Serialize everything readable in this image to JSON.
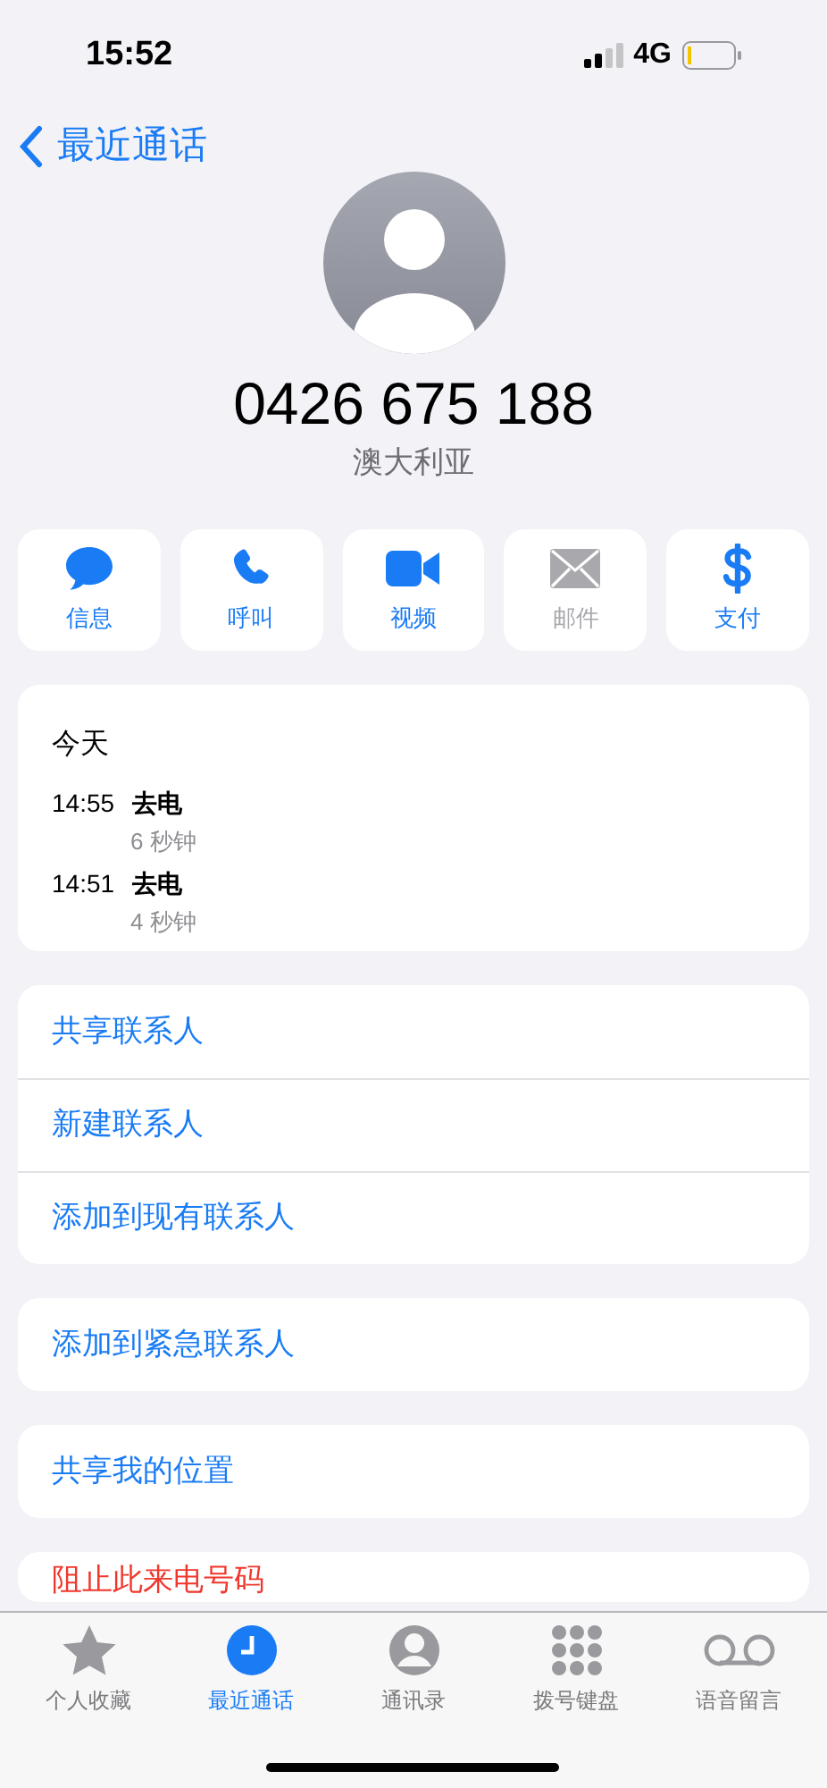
{
  "status_bar": {
    "time": "15:52",
    "network": "4G"
  },
  "nav": {
    "back_label": "最近通话"
  },
  "contact": {
    "number": "0426 675 188",
    "country": "澳大利亚"
  },
  "actions": [
    {
      "kind": "message",
      "label": "信息",
      "disabled": false
    },
    {
      "kind": "call",
      "label": "呼叫",
      "disabled": false
    },
    {
      "kind": "video",
      "label": "视频",
      "disabled": false
    },
    {
      "kind": "mail",
      "label": "邮件",
      "disabled": true
    },
    {
      "kind": "pay",
      "label": "支付",
      "disabled": false
    }
  ],
  "call_log": {
    "day": "今天",
    "entries": [
      {
        "time": "14:55",
        "type": "去电",
        "duration": "6 秒钟"
      },
      {
        "time": "14:51",
        "type": "去电",
        "duration": "4 秒钟"
      }
    ]
  },
  "option_groups": [
    {
      "items": [
        {
          "label": "共享联系人",
          "destructive": false
        },
        {
          "label": "新建联系人",
          "destructive": false
        },
        {
          "label": "添加到现有联系人",
          "destructive": false
        }
      ]
    },
    {
      "items": [
        {
          "label": "添加到紧急联系人",
          "destructive": false
        }
      ]
    },
    {
      "items": [
        {
          "label": "共享我的位置",
          "destructive": false
        }
      ]
    },
    {
      "items": [
        {
          "label": "阻止此来电号码",
          "destructive": true
        }
      ]
    }
  ],
  "tab_bar": [
    {
      "kind": "favorites",
      "label": "个人收藏",
      "selected": false
    },
    {
      "kind": "recents",
      "label": "最近通话",
      "selected": true
    },
    {
      "kind": "contacts",
      "label": "通讯录",
      "selected": false
    },
    {
      "kind": "keypad",
      "label": "拨号键盘",
      "selected": false
    },
    {
      "kind": "voicemail",
      "label": "语音留言",
      "selected": false
    }
  ]
}
